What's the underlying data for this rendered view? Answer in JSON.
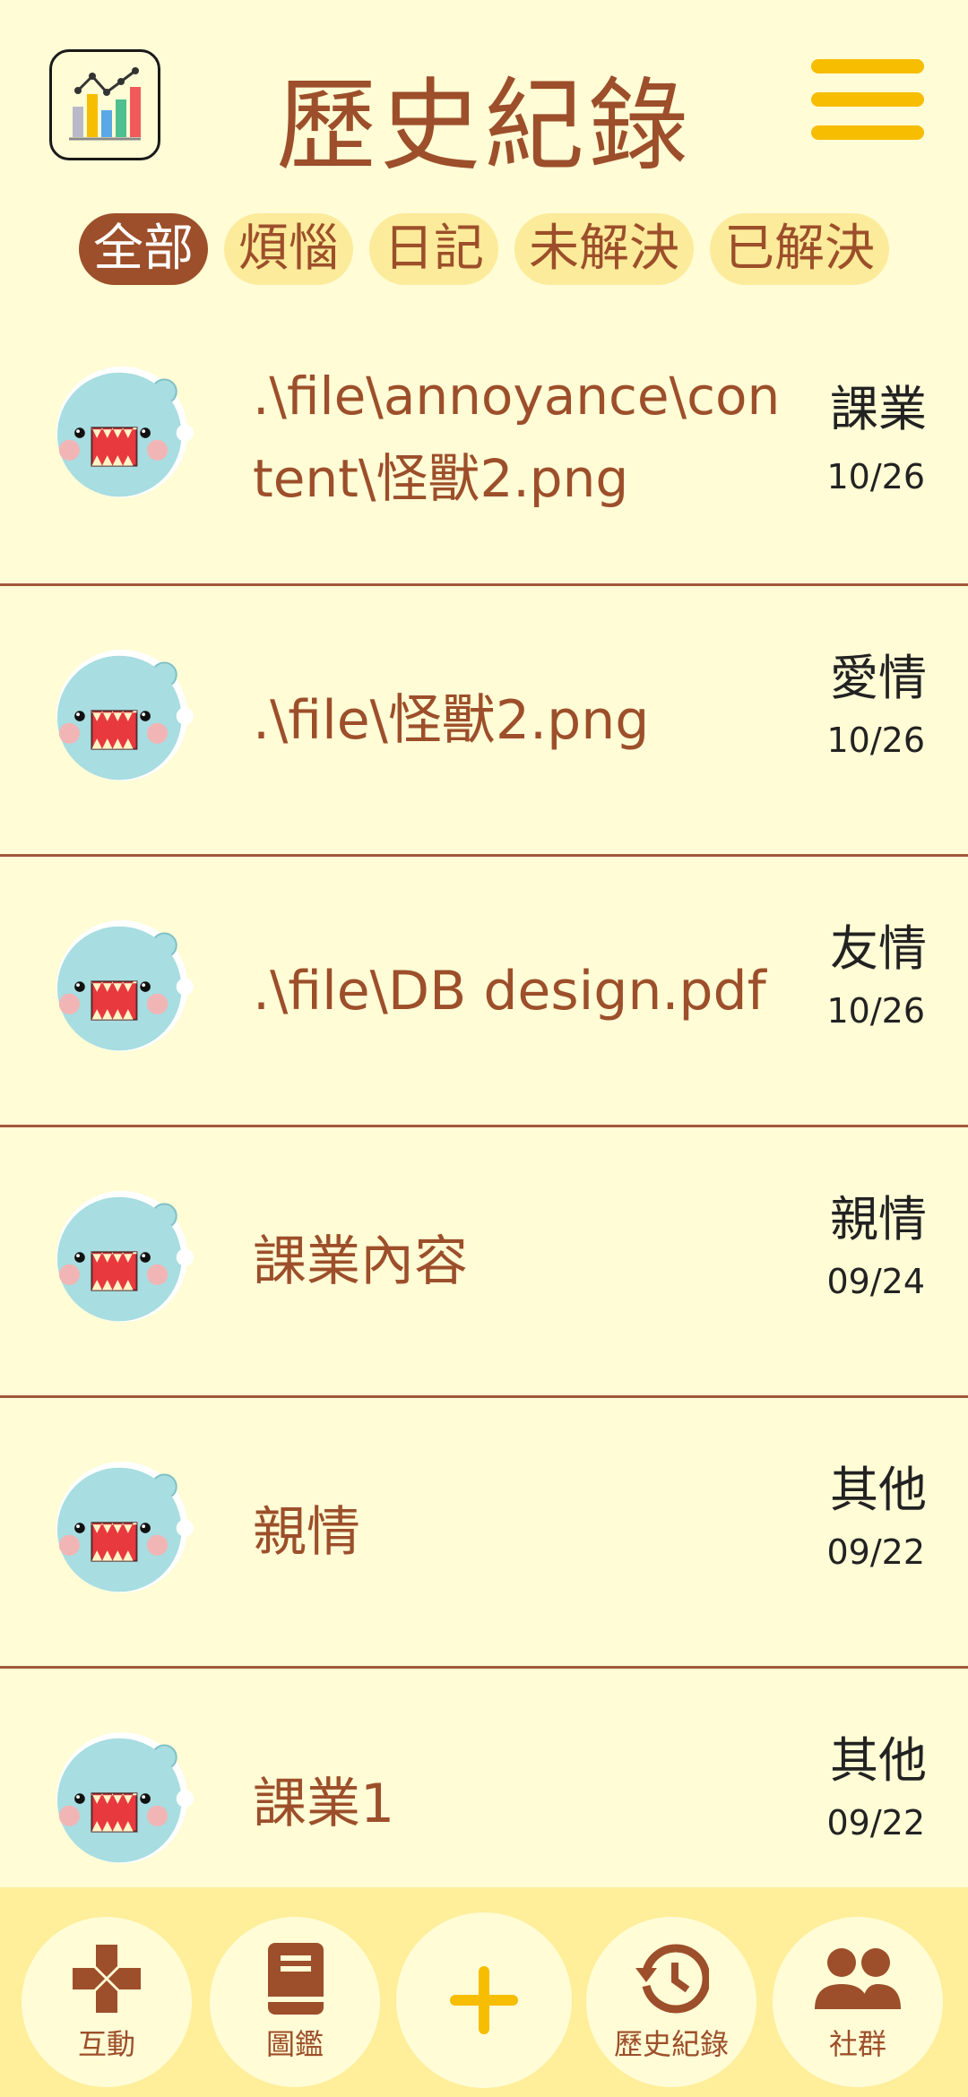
{
  "header": {
    "title": "歷史紀錄",
    "logo_icon": "chart-logo-icon",
    "menu_icon": "hamburger-menu-icon"
  },
  "filters": [
    {
      "label": "全部",
      "active": true
    },
    {
      "label": "煩惱",
      "active": false
    },
    {
      "label": "日記",
      "active": false
    },
    {
      "label": "未解決",
      "active": false
    },
    {
      "label": "已解決",
      "active": false
    }
  ],
  "records": [
    {
      "title": ".\\file\\annoyance\\content\\怪獸2.png",
      "category": "課業",
      "date": "10/26"
    },
    {
      "title": ".\\file\\怪獸2.png",
      "category": "愛情",
      "date": "10/26"
    },
    {
      "title": ".\\file\\DB design.pdf",
      "category": "友情",
      "date": "10/26"
    },
    {
      "title": "課業內容",
      "category": "親情",
      "date": "09/24"
    },
    {
      "title": "親情",
      "category": "其他",
      "date": "09/22"
    },
    {
      "title": "課業1",
      "category": "其他",
      "date": "09/22"
    }
  ],
  "bottom_nav": [
    {
      "label": "互動",
      "icon": "gamepad-icon"
    },
    {
      "label": "圖鑑",
      "icon": "book-icon"
    },
    {
      "label": "",
      "icon": "plus-icon"
    },
    {
      "label": "歷史紀錄",
      "icon": "history-icon"
    },
    {
      "label": "社群",
      "icon": "people-icon"
    }
  ],
  "colors": {
    "background": "#FFFCD6",
    "primary_brown": "#9C4F2A",
    "accent_yellow": "#F7BD00",
    "chip_bg": "#FCEB9A",
    "nav_bg": "#FFEE9A",
    "monster_body": "#A8DDE1"
  }
}
